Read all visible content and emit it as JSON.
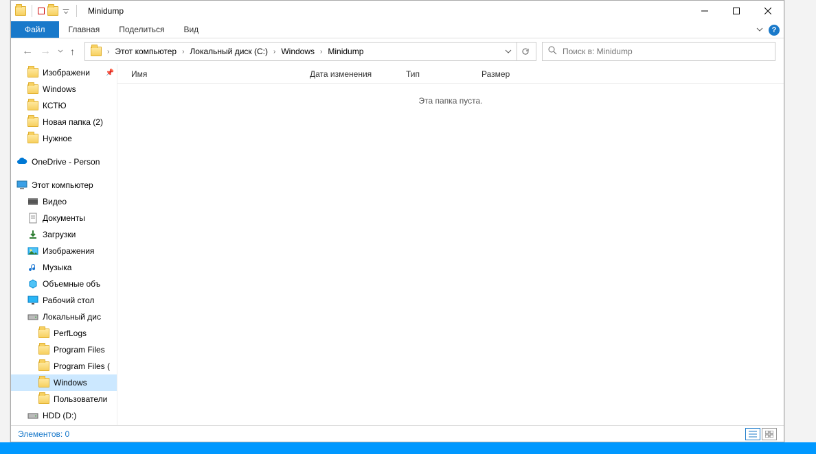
{
  "title": "Minidump",
  "ribbon": {
    "file": "Файл",
    "tabs": [
      "Главная",
      "Поделиться",
      "Вид"
    ]
  },
  "breadcrumbs": [
    "Этот компьютер",
    "Локальный диск (C:)",
    "Windows",
    "Minidump"
  ],
  "search": {
    "placeholder": "Поиск в: Minidump"
  },
  "columns": {
    "name": "Имя",
    "date": "Дата изменения",
    "type": "Тип",
    "size": "Размер"
  },
  "empty_message": "Эта папка пуста.",
  "sidebar_quick": [
    {
      "label": "Изображени",
      "icon": "folder",
      "pinned": true
    },
    {
      "label": "Windows",
      "icon": "folder"
    },
    {
      "label": "КСТЮ",
      "icon": "folder"
    },
    {
      "label": "Новая папка (2)",
      "icon": "folder"
    },
    {
      "label": "Нужное",
      "icon": "folder"
    }
  ],
  "sidebar_onedrive": {
    "label": "OneDrive - Person",
    "icon": "cloud"
  },
  "sidebar_pc": {
    "label": "Этот компьютер",
    "icon": "pc"
  },
  "sidebar_pc_items": [
    {
      "label": "Видео",
      "icon": "video"
    },
    {
      "label": "Документы",
      "icon": "doc"
    },
    {
      "label": "Загрузки",
      "icon": "download"
    },
    {
      "label": "Изображения",
      "icon": "images"
    },
    {
      "label": "Музыка",
      "icon": "music"
    },
    {
      "label": "Объемные объ",
      "icon": "3d"
    },
    {
      "label": "Рабочий стол",
      "icon": "desktop"
    },
    {
      "label": "Локальный дис",
      "icon": "disk"
    }
  ],
  "sidebar_disk_items": [
    {
      "label": "PerfLogs",
      "icon": "folder"
    },
    {
      "label": "Program Files",
      "icon": "folder"
    },
    {
      "label": "Program Files (",
      "icon": "folder"
    },
    {
      "label": "Windows",
      "icon": "folder",
      "selected": true
    },
    {
      "label": "Пользователи",
      "icon": "folder"
    }
  ],
  "sidebar_hdd": {
    "label": "HDD (D:)",
    "icon": "disk"
  },
  "status": {
    "items": "Элементов: 0"
  }
}
